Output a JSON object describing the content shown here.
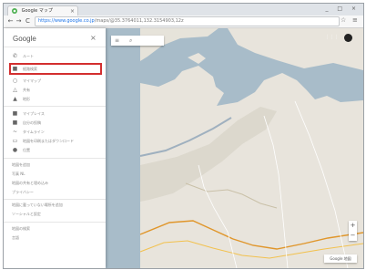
{
  "browser": {
    "tab_title": "Google マップ",
    "tab_close": "×",
    "window_controls": "_ □ ×",
    "back": "←",
    "forward": "→",
    "reload": "C",
    "url_host": "https://www.google.co.jp",
    "url_path": "/maps/@35.3764011,132.3154903,12z",
    "star_icon": "☆",
    "menu_icon": "≡"
  },
  "sidebar": {
    "brand": "Google",
    "close": "×",
    "group1": [
      {
        "icon": "✆",
        "label": "ルート"
      },
      {
        "icon": "■",
        "label": "経路検索"
      },
      {
        "icon": "○",
        "label": "マイマップ"
      },
      {
        "icon": "△",
        "label": "共有"
      },
      {
        "icon": "▲",
        "label": "地形"
      }
    ],
    "group2": [
      {
        "icon": "■",
        "label": "マイプレイス"
      },
      {
        "icon": "■",
        "label": "自分の投稿"
      },
      {
        "icon": "~",
        "label": "タイムライン"
      },
      {
        "icon": "▭",
        "label": "地図を印刷またはダウンロード"
      },
      {
        "icon": "●",
        "label": "位置"
      }
    ],
    "group3": [
      "地図を追加",
      "写真 NL",
      "地図の共有と埋め込み",
      "プライバシー"
    ],
    "group4": [
      "地図に載っていない場所を追加",
      "ソーシャルと設定"
    ],
    "group5": [
      "地図の検索",
      "言語"
    ]
  },
  "map": {
    "search_menu_icon": "≡",
    "search_icon": "⌕",
    "apps_icon": "⋮⋮⋮",
    "zoom_in": "+",
    "zoom_out": "−",
    "footer_label": "Google 地図"
  },
  "colors": {
    "water": "#a8bcc9",
    "land": "#e8e4dc",
    "highlight": "#d32f2f"
  }
}
